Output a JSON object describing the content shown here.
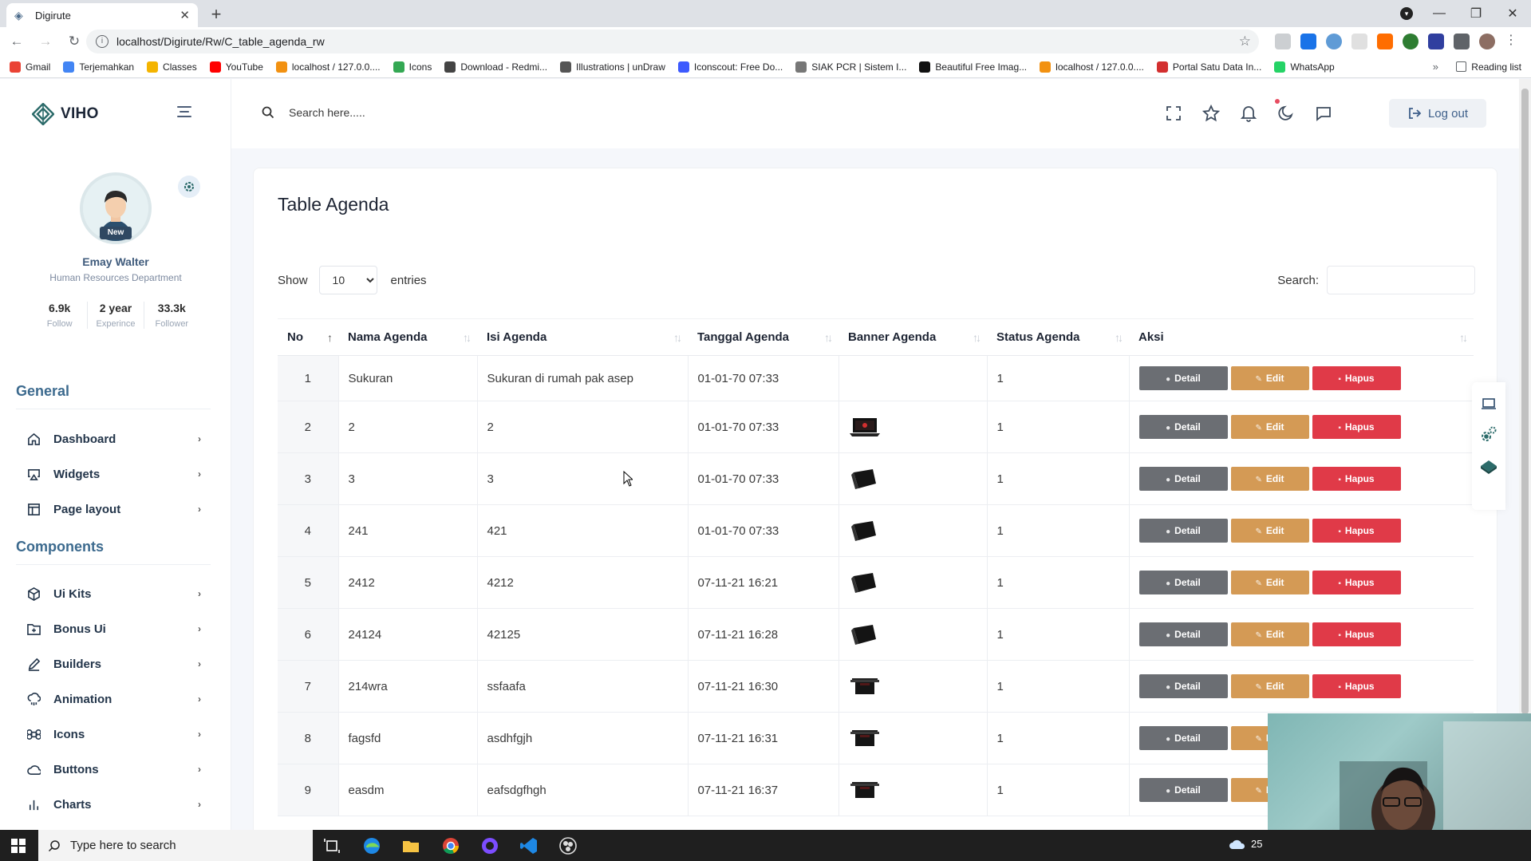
{
  "browser": {
    "tab_title": "Digirute",
    "url": "localhost/Digirute/Rw/C_table_agenda_rw",
    "bookmarks": [
      {
        "label": "Gmail",
        "color": "#ea4335"
      },
      {
        "label": "Terjemahkan",
        "color": "#4285f4"
      },
      {
        "label": "Classes",
        "color": "#f4b400"
      },
      {
        "label": "YouTube",
        "color": "#ff0000"
      },
      {
        "label": "localhost / 127.0.0....",
        "color": "#f29111"
      },
      {
        "label": "Icons",
        "color": "#34a853"
      },
      {
        "label": "Download - Redmi...",
        "color": "#444444"
      },
      {
        "label": "Illustrations | unDraw",
        "color": "#555555"
      },
      {
        "label": "Iconscout: Free Do...",
        "color": "#3d5afe"
      },
      {
        "label": "SIAK PCR | Sistem I...",
        "color": "#777777"
      },
      {
        "label": "Beautiful Free Imag...",
        "color": "#111111"
      },
      {
        "label": "localhost / 127.0.0....",
        "color": "#f29111"
      },
      {
        "label": "Portal Satu Data In...",
        "color": "#d32f2f"
      },
      {
        "label": "WhatsApp",
        "color": "#25d366"
      }
    ],
    "more": "»",
    "reading_list": "Reading list"
  },
  "app": {
    "logo": "VIHO",
    "search_placeholder": "Search here.....",
    "logout_label": "Log out"
  },
  "profile": {
    "badge": "New",
    "name": "Emay Walter",
    "department": "Human Resources Department",
    "stats": [
      {
        "value": "6.9k",
        "label": "Follow"
      },
      {
        "value": "2 year",
        "label": "Experince"
      },
      {
        "value": "33.3k",
        "label": "Follower"
      }
    ]
  },
  "sidebar": {
    "general_title": "General",
    "general_items": [
      {
        "label": "Dashboard",
        "icon": "home-icon"
      },
      {
        "label": "Widgets",
        "icon": "airplay-icon"
      },
      {
        "label": "Page layout",
        "icon": "layout-icon"
      }
    ],
    "components_title": "Components",
    "components_items": [
      {
        "label": "Ui Kits",
        "icon": "box-icon"
      },
      {
        "label": "Bonus Ui",
        "icon": "folder-plus-icon"
      },
      {
        "label": "Builders",
        "icon": "edit-icon"
      },
      {
        "label": "Animation",
        "icon": "cloud-drizzle-icon"
      },
      {
        "label": "Icons",
        "icon": "command-icon"
      },
      {
        "label": "Buttons",
        "icon": "cloud-icon"
      },
      {
        "label": "Charts",
        "icon": "bar-chart-icon"
      }
    ]
  },
  "table_card": {
    "title": "Table Agenda",
    "show_label": "Show",
    "page_length": "10",
    "entries_label": "entries",
    "search_label": "Search:",
    "columns": [
      "No",
      "Nama Agenda",
      "Isi Agenda",
      "Tanggal Agenda",
      "Banner Agenda",
      "Status Agenda",
      "Aksi"
    ],
    "actions": {
      "detail": "Detail",
      "edit": "Edit",
      "hapus": "Hapus"
    },
    "rows": [
      {
        "no": "1",
        "nama": "Sukuran",
        "isi": "Sukuran di rumah pak asep",
        "tanggal": "01-01-70 07:33",
        "banner": "none",
        "status": "1"
      },
      {
        "no": "2",
        "nama": "2",
        "isi": "2",
        "tanggal": "01-01-70 07:33",
        "banner": "laptop-open",
        "status": "1"
      },
      {
        "no": "3",
        "nama": "3",
        "isi": "3",
        "tanggal": "01-01-70 07:33",
        "banner": "laptop-angle",
        "status": "1"
      },
      {
        "no": "4",
        "nama": "241",
        "isi": "421",
        "tanggal": "01-01-70 07:33",
        "banner": "laptop-angle",
        "status": "1"
      },
      {
        "no": "5",
        "nama": "2412",
        "isi": "4212",
        "tanggal": "07-11-21 16:21",
        "banner": "laptop-angle",
        "status": "1"
      },
      {
        "no": "6",
        "nama": "24124",
        "isi": "42125",
        "tanggal": "07-11-21 16:28",
        "banner": "laptop-angle",
        "status": "1"
      },
      {
        "no": "7",
        "nama": "214wra",
        "isi": "ssfaafa",
        "tanggal": "07-11-21 16:30",
        "banner": "laptop-front",
        "status": "1"
      },
      {
        "no": "8",
        "nama": "fagsfd",
        "isi": "asdhfgjh",
        "tanggal": "07-11-21 16:31",
        "banner": "laptop-front",
        "status": "1"
      },
      {
        "no": "9",
        "nama": "easdm",
        "isi": "eafsdgfhgh",
        "tanggal": "07-11-21 16:37",
        "banner": "laptop-front",
        "status": "1"
      }
    ]
  },
  "taskbar": {
    "search_placeholder": "Type here to search",
    "temperature": "25"
  }
}
